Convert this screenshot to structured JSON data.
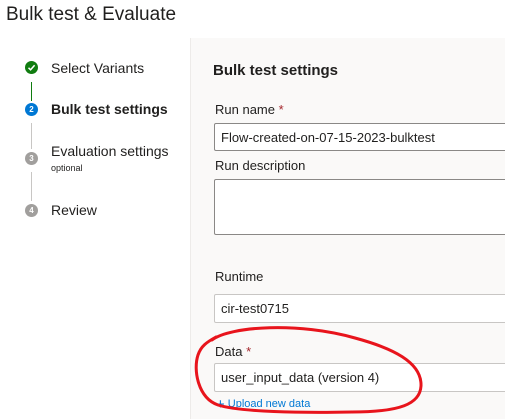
{
  "page": {
    "title": "Bulk test & Evaluate"
  },
  "steps": [
    {
      "label": "Select Variants",
      "status": "completed"
    },
    {
      "label": "Bulk test settings",
      "status": "current",
      "number": "2"
    },
    {
      "label": "Evaluation settings",
      "sub": "optional",
      "status": "pending",
      "number": "3"
    },
    {
      "label": "Review",
      "status": "pending",
      "number": "4"
    }
  ],
  "form": {
    "section_title": "Bulk test settings",
    "run_name": {
      "label": "Run name",
      "required": "*",
      "value": "Flow-created-on-07-15-2023-bulktest"
    },
    "run_description": {
      "label": "Run description",
      "value": ""
    },
    "runtime": {
      "label": "Runtime",
      "value": "cir-test0715"
    },
    "data": {
      "label": "Data",
      "required": "*",
      "value": "user_input_data (version 4)"
    },
    "upload_label": "Upload new data"
  },
  "colors": {
    "completed": "#107c10",
    "current": "#0078d4",
    "pending": "#a19f9d",
    "annotation": "#e8141c",
    "link": "#0078d4"
  }
}
